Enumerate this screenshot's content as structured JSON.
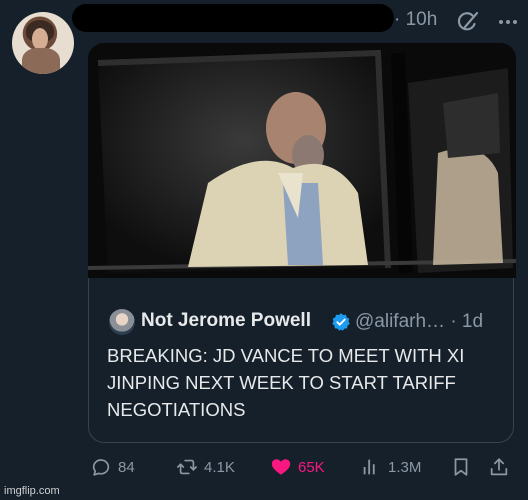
{
  "tweet": {
    "timestamp": "· 10h"
  },
  "quoted": {
    "name": "Not Jerome Powell",
    "handle": "@alifarh… · 1d",
    "text": "BREAKING: JD VANCE TO MEET WITH XI\nJINPING NEXT WEEK TO START TARIFF\nNEGOTIATIONS"
  },
  "actions": {
    "replies": "84",
    "reposts": "4.1K",
    "likes": "65K",
    "views": "1.3M"
  },
  "colors": {
    "background": "#15202b",
    "secondary_text": "#8b98a5",
    "like_pink": "#f91880",
    "verified_blue": "#1d9bf0"
  },
  "watermark": "imgflip.com"
}
